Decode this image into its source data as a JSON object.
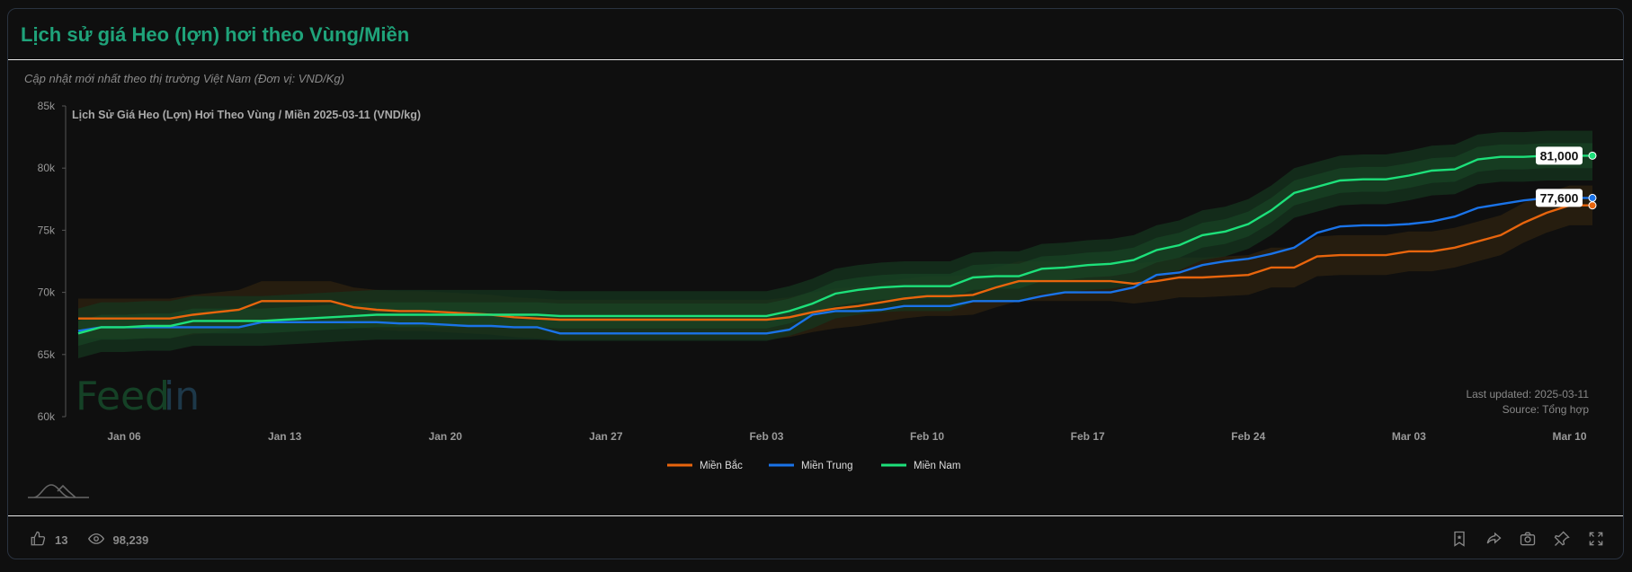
{
  "card": {
    "title": "Lịch sử giá Heo (lợn) hơi theo Vùng/Miền",
    "subtitle": "Cập nhật mới nhất theo thị trường Việt Nam (Đơn vị: VND/Kg)"
  },
  "chart_data": {
    "type": "line",
    "title": "Lịch Sử Giá Heo (Lợn) Hơi Theo Vùng / Miền 2025-03-11 (VND/kg)",
    "xlabel": "",
    "ylabel": "",
    "x_start": "2025-01-04",
    "x_end": "2025-03-11",
    "x_ticks": [
      "Jan 06",
      "Jan 13",
      "Jan 20",
      "Jan 27",
      "Feb 03",
      "Feb 10",
      "Feb 17",
      "Feb 24",
      "Mar 03",
      "Mar 10"
    ],
    "x_tick_day_index": [
      2,
      9,
      16,
      23,
      30,
      37,
      44,
      51,
      58,
      65
    ],
    "y_ticks": [
      "60k",
      "65k",
      "70k",
      "75k",
      "80k",
      "85k"
    ],
    "ylim": [
      60000,
      85000
    ],
    "grid": false,
    "legend_position": "bottom",
    "series": [
      {
        "name": "Miền Bắc",
        "color": "#e8650d",
        "values": [
          67900,
          67900,
          67900,
          67900,
          67900,
          68200,
          68400,
          68600,
          69300,
          69300,
          69300,
          69300,
          68800,
          68600,
          68500,
          68500,
          68400,
          68300,
          68200,
          68000,
          67900,
          67800,
          67800,
          67800,
          67800,
          67800,
          67800,
          67800,
          67800,
          67800,
          67800,
          68000,
          68400,
          68700,
          68900,
          69200,
          69500,
          69700,
          69700,
          69800,
          70400,
          70900,
          70900,
          70900,
          70900,
          70900,
          70700,
          70900,
          71200,
          71200,
          71300,
          71400,
          72000,
          72000,
          72900,
          73000,
          73000,
          73000,
          73300,
          73300,
          73600,
          74100,
          74600,
          75600,
          76400,
          77000,
          77000
        ]
      },
      {
        "name": "Miền Trung",
        "color": "#1a73e8",
        "values": [
          66900,
          67200,
          67200,
          67200,
          67200,
          67200,
          67200,
          67200,
          67600,
          67600,
          67600,
          67600,
          67600,
          67600,
          67500,
          67500,
          67400,
          67300,
          67300,
          67200,
          67200,
          66700,
          66700,
          66700,
          66700,
          66700,
          66700,
          66700,
          66700,
          66700,
          66700,
          67000,
          68200,
          68500,
          68500,
          68600,
          68900,
          68900,
          68900,
          69300,
          69300,
          69300,
          69700,
          70000,
          70000,
          70000,
          70400,
          71400,
          71600,
          72200,
          72500,
          72700,
          73100,
          73600,
          74800,
          75300,
          75400,
          75400,
          75500,
          75700,
          76100,
          76800,
          77100,
          77400,
          77600,
          77600,
          77600
        ],
        "end_label": "77,600"
      },
      {
        "name": "Miền Nam",
        "color": "#1de07a",
        "values": [
          66700,
          67200,
          67200,
          67300,
          67300,
          67700,
          67700,
          67700,
          67700,
          67800,
          67900,
          68000,
          68100,
          68200,
          68200,
          68200,
          68200,
          68200,
          68200,
          68200,
          68200,
          68100,
          68100,
          68100,
          68100,
          68100,
          68100,
          68100,
          68100,
          68100,
          68100,
          68500,
          69100,
          69900,
          70200,
          70400,
          70500,
          70500,
          70500,
          71200,
          71300,
          71300,
          71900,
          72000,
          72200,
          72300,
          72600,
          73400,
          73800,
          74600,
          74900,
          75500,
          76600,
          78000,
          78500,
          79000,
          79100,
          79100,
          79400,
          79800,
          79900,
          80700,
          80900,
          80900,
          81000,
          81000,
          81000
        ],
        "end_label": "81,000"
      }
    ],
    "annotations": [
      "Last updated: 2025-03-11",
      "Source: Tổng hợp"
    ],
    "watermark": "Feedin"
  },
  "footer": {
    "likes": "13",
    "views": "98,239",
    "actions": [
      "bookmark-icon",
      "share-icon",
      "camera-icon",
      "pin-icon",
      "fullscreen-icon"
    ]
  }
}
